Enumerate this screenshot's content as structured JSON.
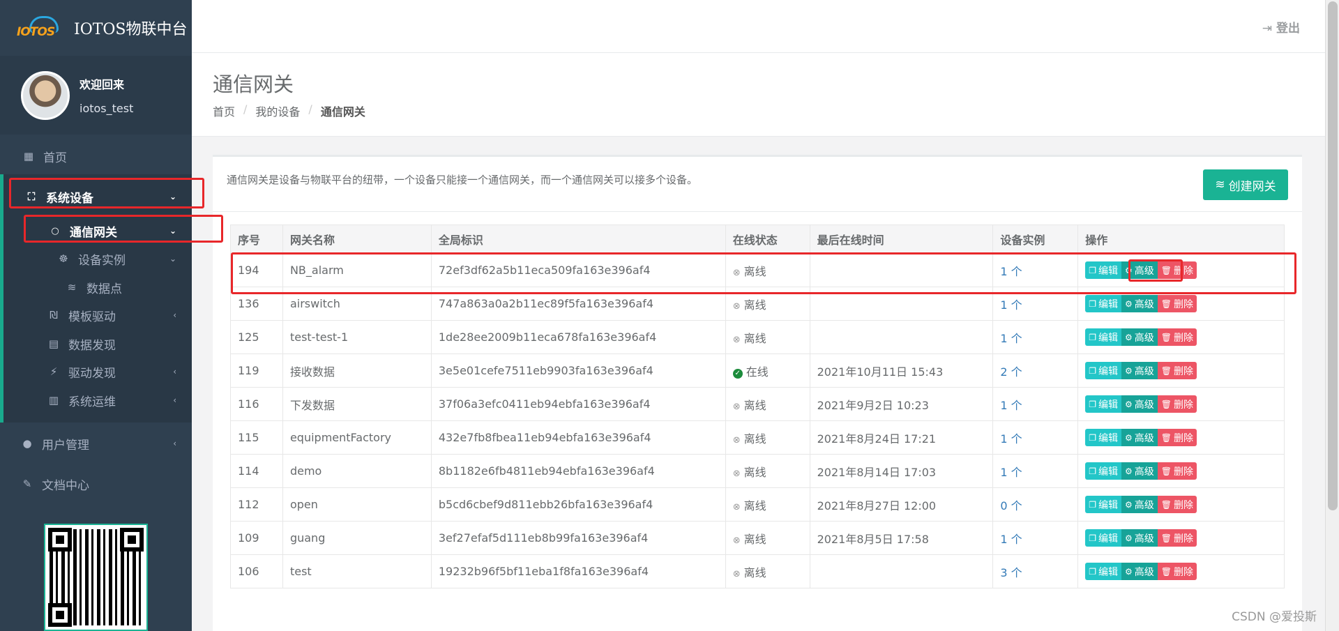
{
  "brand": {
    "logo_text": "IOTOS",
    "title": "IOTOS物联中台"
  },
  "profile": {
    "welcome": "欢迎回来",
    "username": "iotos_test"
  },
  "nav": {
    "home": "首页",
    "system_devices": "系统设备",
    "gateway": "通信网关",
    "device_instances": "设备实例",
    "data_points": "数据点",
    "template_driver": "模板驱动",
    "data_discovery": "数据发现",
    "driver_discovery": "驱动发现",
    "system_ops": "系统运维",
    "user_mgmt": "用户管理",
    "doc_center": "文档中心"
  },
  "topbar": {
    "logout": "登出"
  },
  "page": {
    "title": "通信网关",
    "breadcrumb": [
      "首页",
      "我的设备",
      "通信网关"
    ]
  },
  "panel": {
    "description": "通信网关是设备与物联平台的纽带，一个设备只能接一个通信网关，而一个通信网关可以接多个设备。",
    "create_button": "创建网关"
  },
  "table": {
    "headers": [
      "序号",
      "网关名称",
      "全局标识",
      "在线状态",
      "最后在线时间",
      "设备实例",
      "操作"
    ],
    "rows": [
      {
        "id": "194",
        "name": "NB_alarm",
        "uid": "72ef3df62a5b11eca509fa163e396af4",
        "status": "离线",
        "last": "",
        "instances": "1 个"
      },
      {
        "id": "136",
        "name": "airswitch",
        "uid": "747a863a0a2b11ec89f5fa163e396af4",
        "status": "离线",
        "last": "",
        "instances": "1 个"
      },
      {
        "id": "125",
        "name": "test-test-1",
        "uid": "1de28ee2009b11eca678fa163e396af4",
        "status": "离线",
        "last": "",
        "instances": "1 个"
      },
      {
        "id": "119",
        "name": "接收数据",
        "uid": "3e5e01cefe7511eb9903fa163e396af4",
        "status": "在线",
        "last": "2021年10月11日 15:43",
        "instances": "2 个"
      },
      {
        "id": "116",
        "name": "下发数据",
        "uid": "37f06a3efc0411eb94ebfa163e396af4",
        "status": "离线",
        "last": "2021年9月2日 10:23",
        "instances": "1 个"
      },
      {
        "id": "115",
        "name": "equipmentFactory",
        "uid": "432e7fb8fbea11eb94ebfa163e396af4",
        "status": "离线",
        "last": "2021年8月24日 17:21",
        "instances": "1 个"
      },
      {
        "id": "114",
        "name": "demo",
        "uid": "8b1182e6fb4811eb94ebfa163e396af4",
        "status": "离线",
        "last": "2021年8月14日 17:03",
        "instances": "1 个"
      },
      {
        "id": "112",
        "name": "open",
        "uid": "b5cd6cbef9d811ebb26bfa163e396af4",
        "status": "离线",
        "last": "2021年8月27日 12:00",
        "instances": "0 个"
      },
      {
        "id": "109",
        "name": "guang",
        "uid": "3ef27efaf5d111eb8b99fa163e396af4",
        "status": "离线",
        "last": "2021年8月5日 17:58",
        "instances": "1 个"
      },
      {
        "id": "106",
        "name": "test",
        "uid": "19232b96f5bf11eba1f8fa163e396af4",
        "status": "离线",
        "last": "",
        "instances": "3 个"
      }
    ],
    "actions": {
      "edit": "编辑",
      "advanced": "高级",
      "delete": "删除"
    }
  },
  "watermark": "CSDN @爱投斯",
  "colors": {
    "sidebar": "#2f4050",
    "accent": "#1ab394",
    "edit": "#23c6c8",
    "advanced": "#17a398",
    "delete": "#ed5565",
    "annotation": "#e8272a"
  }
}
